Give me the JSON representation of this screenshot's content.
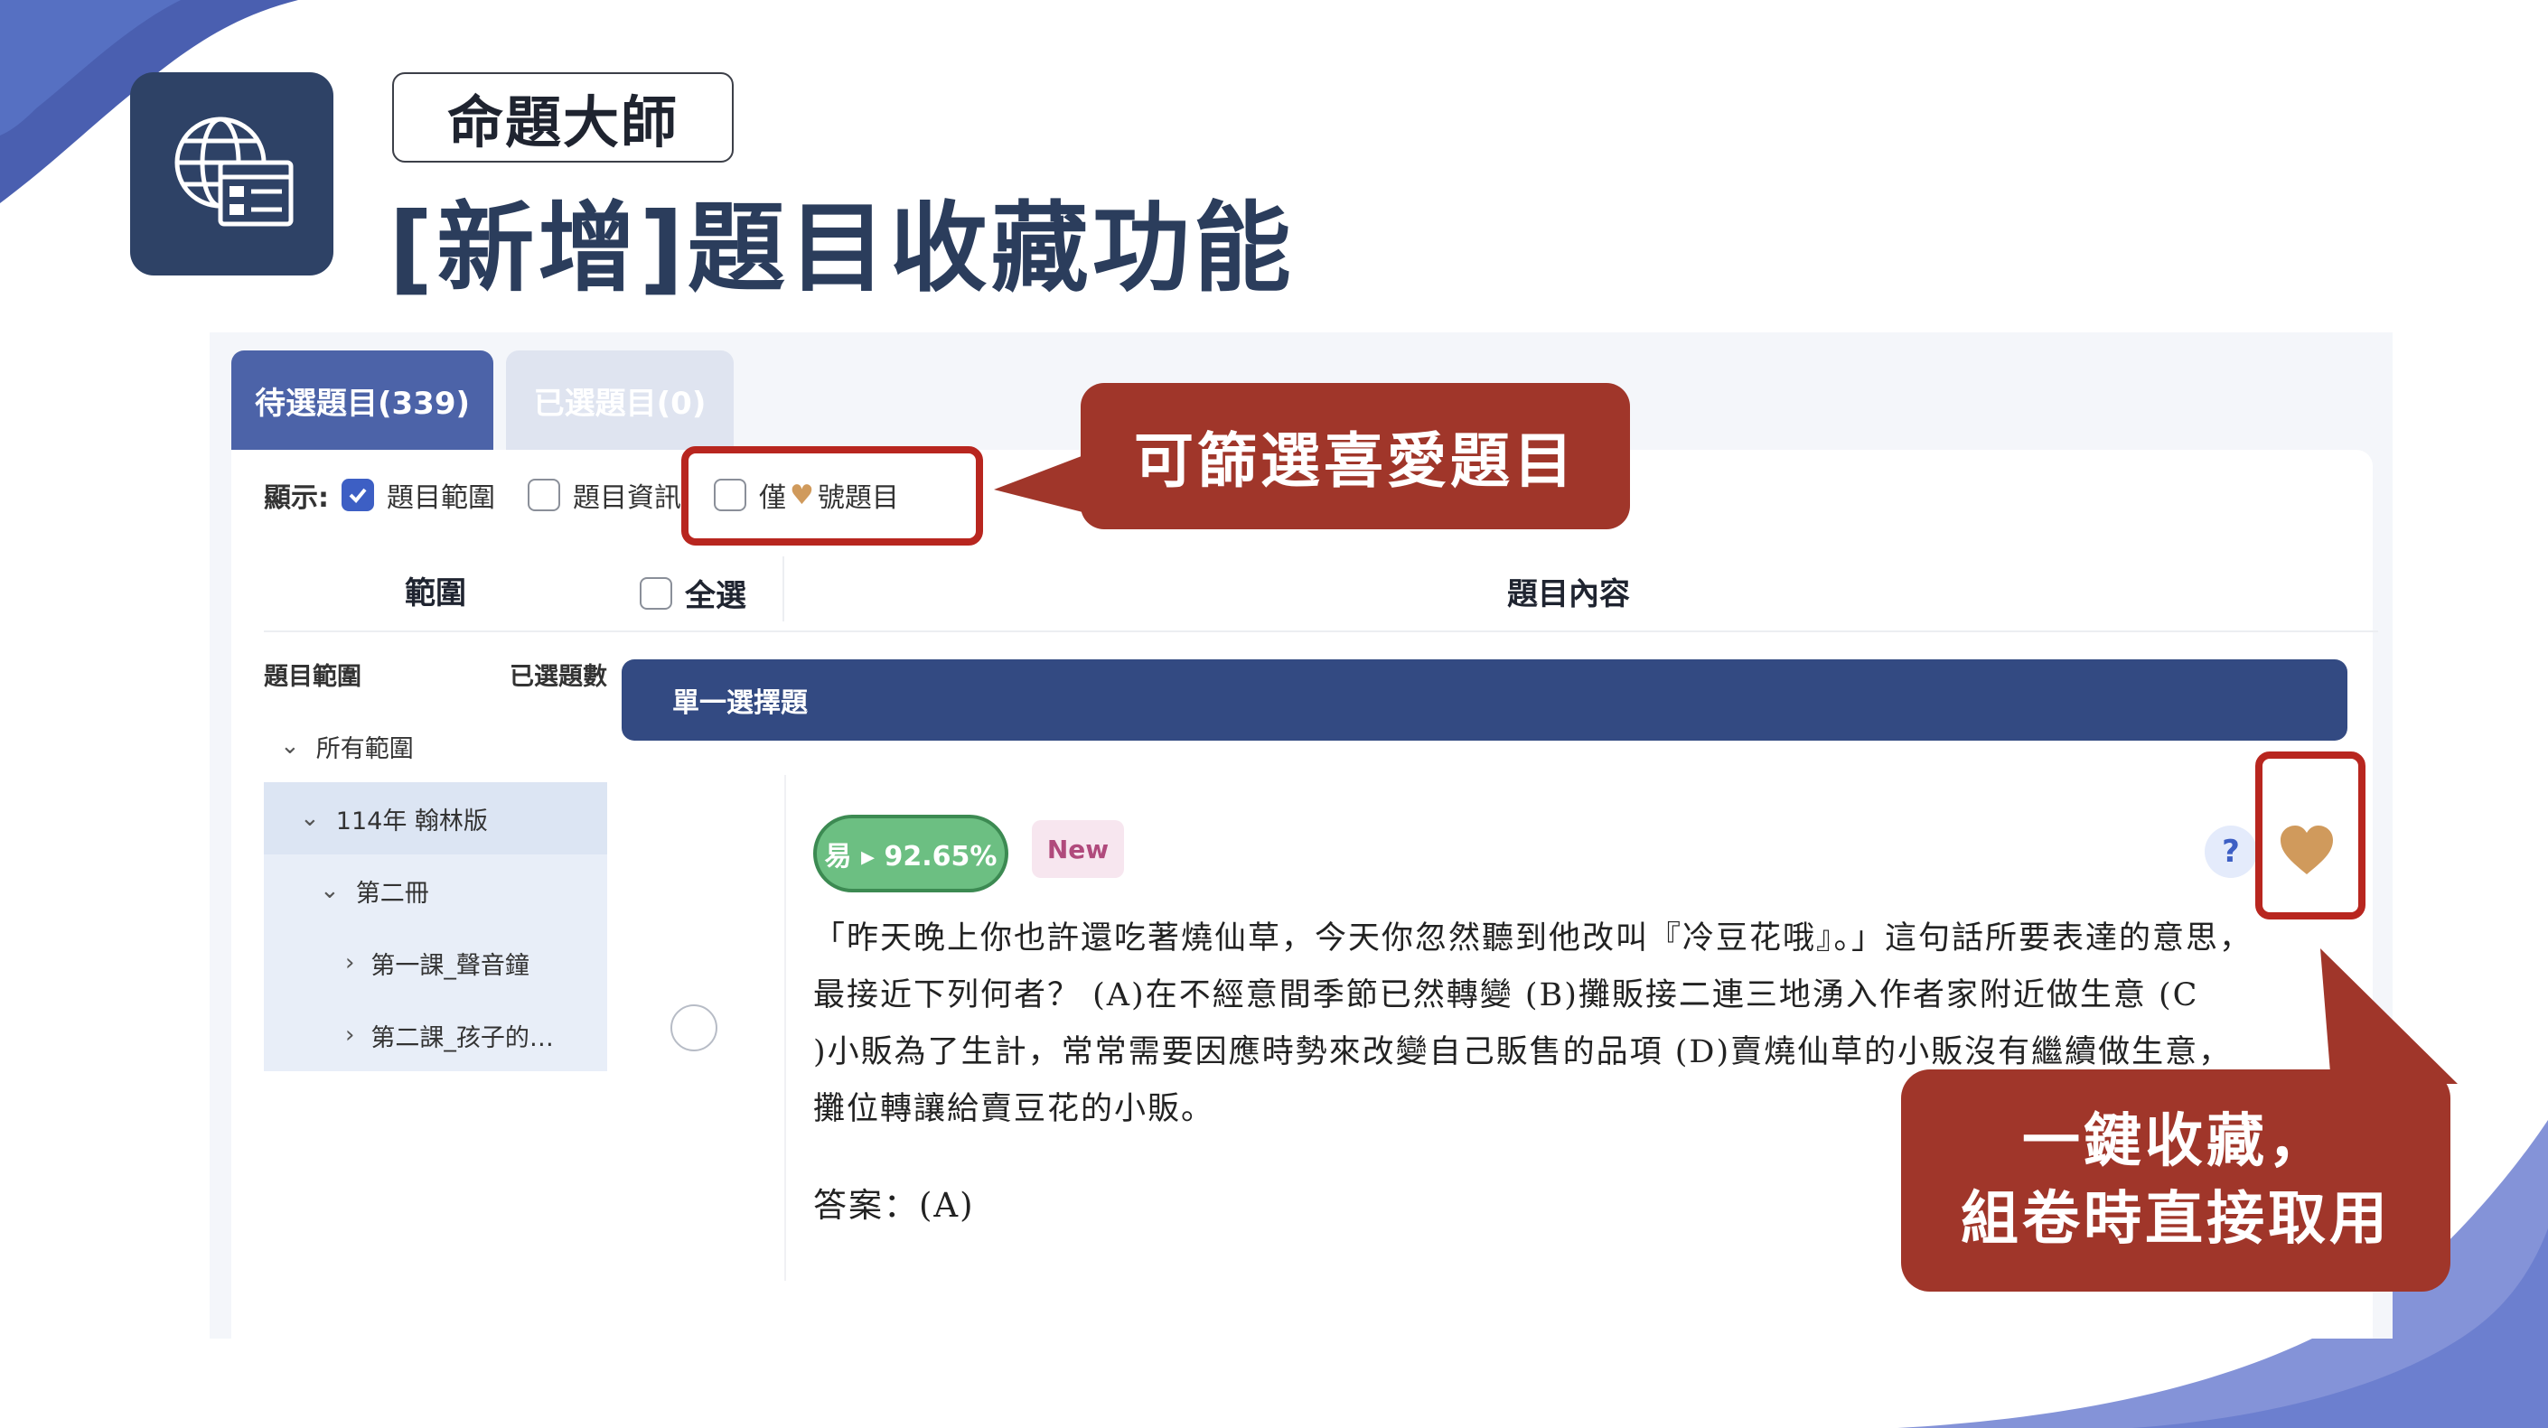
{
  "header": {
    "product_name": "命題大師",
    "title": "[新增]題目收藏功能",
    "logo_icon": "globe-browser-icon"
  },
  "tabs": [
    {
      "label": "待選題目(339)",
      "active": true
    },
    {
      "label": "已選題目(0)",
      "active": false
    }
  ],
  "filters": {
    "display_label": "顯示:",
    "options": [
      {
        "label": "題目範圍",
        "checked": true
      },
      {
        "label": "題目資訊",
        "checked": false
      }
    ],
    "favorite_only": {
      "prefix": "僅",
      "suffix": "號題目",
      "icon": "heart-icon",
      "checked": false
    }
  },
  "columns": {
    "range": "範圍",
    "select_all": "全選",
    "content": "題目內容"
  },
  "range_tree": {
    "header_left": "題目範圍",
    "header_right": "已選題數",
    "items": [
      {
        "label": "所有範圍",
        "chevron": "down"
      },
      {
        "label": "114年 翰林版",
        "chevron": "down"
      },
      {
        "label": "第二冊",
        "chevron": "down"
      },
      {
        "label": "第一課_聲音鐘",
        "chevron": "right"
      },
      {
        "label": "第二課_孩子的…",
        "chevron": "right"
      }
    ]
  },
  "question_section": {
    "type_label": "單一選擇題",
    "question": {
      "difficulty_badge": "易 ▸ 92.65%",
      "new_badge": "New",
      "help_label": "?",
      "lines": [
        "「昨天晚上你也許還吃著燒仙草，今天你忽然聽到他改叫『冷豆花哦』。」這句話所要表達的意思，",
        "最接近下列何者？ (A)在不經意間季節已然轉變 (B)攤販接二連三地湧入作者家附近做生意 (C",
        ")小販為了生計，常常需要因應時勢來改變自己販售的品項 (D)賣燒仙草的小販沒有繼續做生意，",
        "攤位轉讓給賣豆花的小販。"
      ],
      "answer": "答案：(A)"
    }
  },
  "callouts": {
    "filter": "可篩選喜愛題目",
    "favorite_line1": "一鍵收藏，",
    "favorite_line2": "組卷時直接取用"
  },
  "colors": {
    "brand_navy": "#2e4266",
    "tab_active": "#4c63a8",
    "question_bar": "#334a82",
    "callout": "#a0362a",
    "highlight": "#b8261f",
    "heart": "#d09a5c",
    "easy_badge": "#6cbf82"
  }
}
